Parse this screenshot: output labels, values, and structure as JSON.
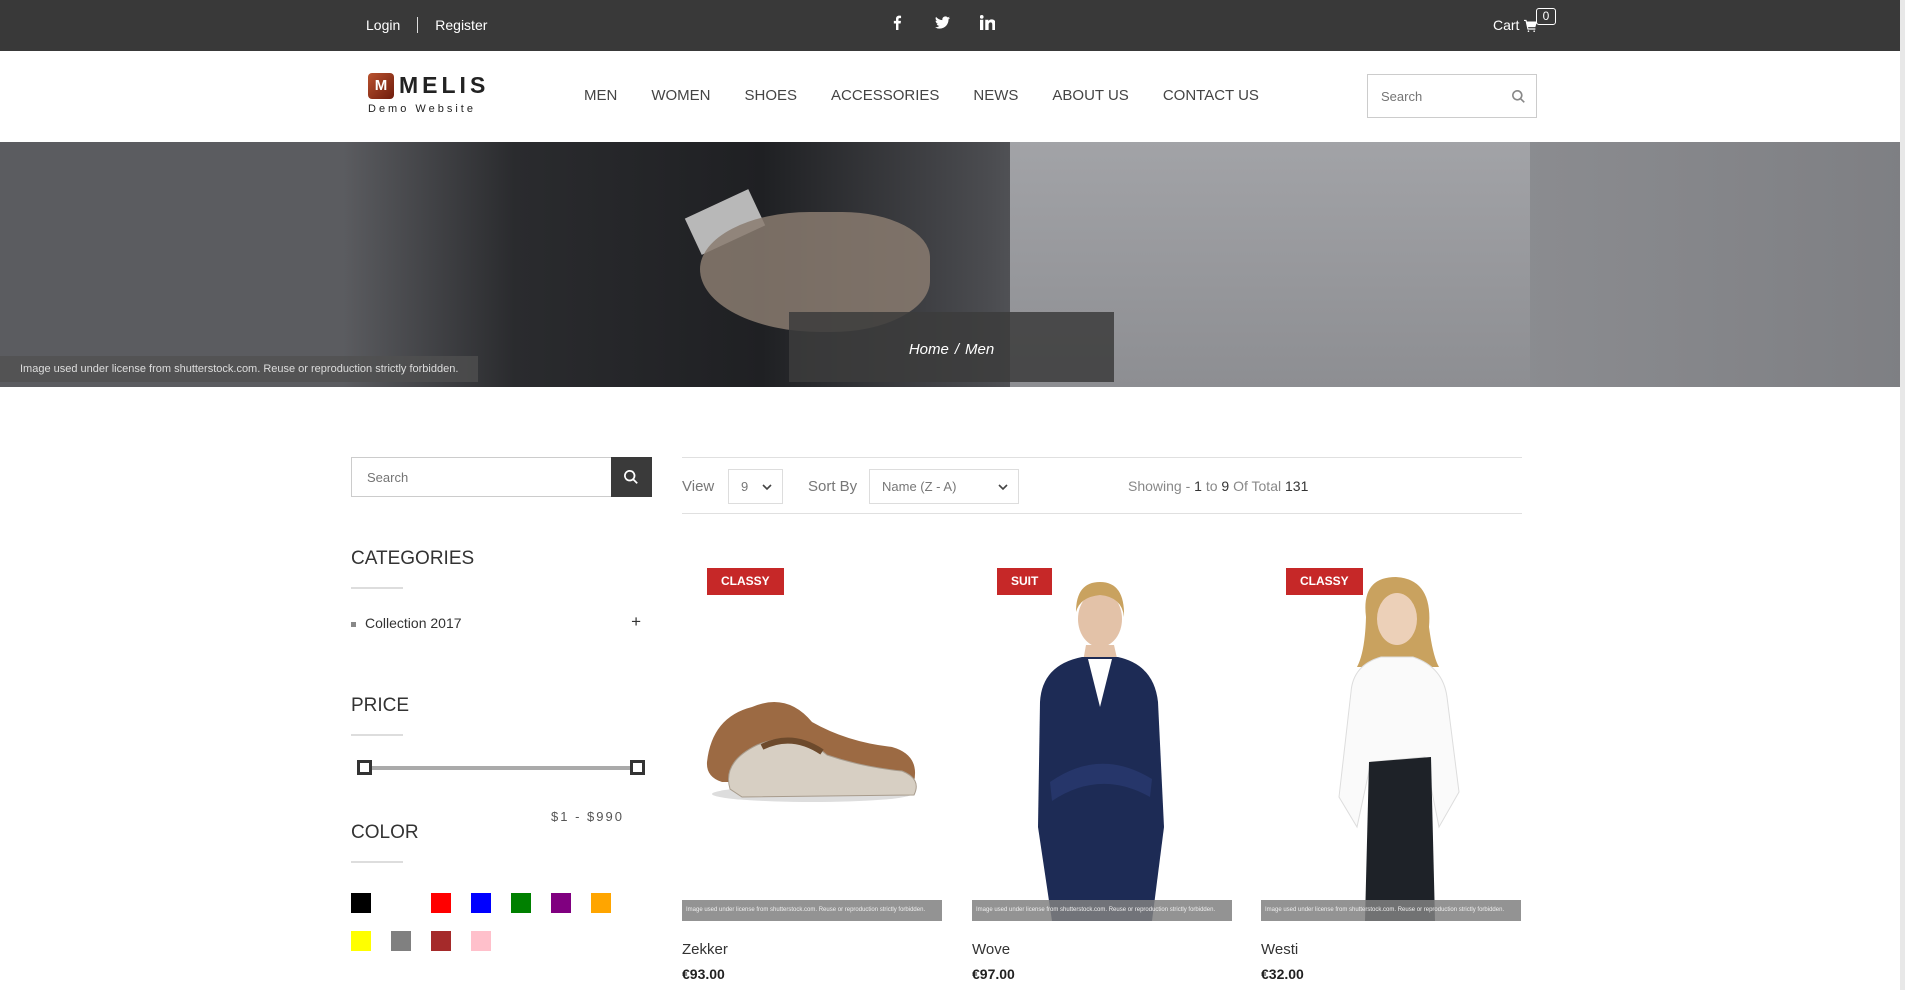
{
  "topbar": {
    "login": "Login",
    "register": "Register",
    "social": [
      "facebook-icon",
      "twitter-icon",
      "linkedin-icon"
    ],
    "cart_label": "Cart",
    "cart_count": "0"
  },
  "header": {
    "logo_letter": "M",
    "logo_name": "MELIS",
    "logo_sub": "Demo Website",
    "nav": [
      "MEN",
      "WOMEN",
      "SHOES",
      "ACCESSORIES",
      "NEWS",
      "ABOUT US",
      "CONTACT US"
    ],
    "search_placeholder": "Search"
  },
  "hero": {
    "license": "Image used under license from shutterstock.com. Reuse or reproduction strictly forbidden.",
    "breadcrumb": [
      "Home",
      "Men"
    ],
    "breadcrumb_sep": "/"
  },
  "sidebar": {
    "search_placeholder": "Search",
    "categories_title": "CATEGORIES",
    "categories": [
      {
        "label": "Collection 2017",
        "expand": "+"
      }
    ],
    "price_title": "PRICE",
    "price_range": "$1 - $990",
    "price_fraction": {
      "min": 0,
      "max": 1
    },
    "color_title": "COLOR",
    "colors": [
      "#000000",
      "#ffffff",
      "#ff0000",
      "#0000ff",
      "#008000",
      "#800080",
      "#ffa500",
      "#ffff00",
      "#808080",
      "#a52a2a",
      "#ffc0cb"
    ]
  },
  "toolbar": {
    "view_label": "View",
    "view_value": "9",
    "sort_label": "Sort By",
    "sort_value": "Name (Z - A)",
    "showing_prefix": "Showing -",
    "showing_from": "1",
    "showing_to_word": "to",
    "showing_to": "9",
    "showing_total_word": "Of Total",
    "showing_total": "131"
  },
  "products": [
    {
      "badge": "CLASSY",
      "name": "Zekker",
      "price": "€93.00",
      "license": "Image used under license from shutterstock.com. Reuse or reproduction strictly forbidden."
    },
    {
      "badge": "SUIT",
      "name": "Wove",
      "price": "€97.00",
      "license": "Image used under license from shutterstock.com. Reuse or reproduction strictly forbidden."
    },
    {
      "badge": "CLASSY",
      "name": "Westi",
      "price": "€32.00",
      "license": "Image used under license from shutterstock.com. Reuse or reproduction strictly forbidden."
    }
  ]
}
